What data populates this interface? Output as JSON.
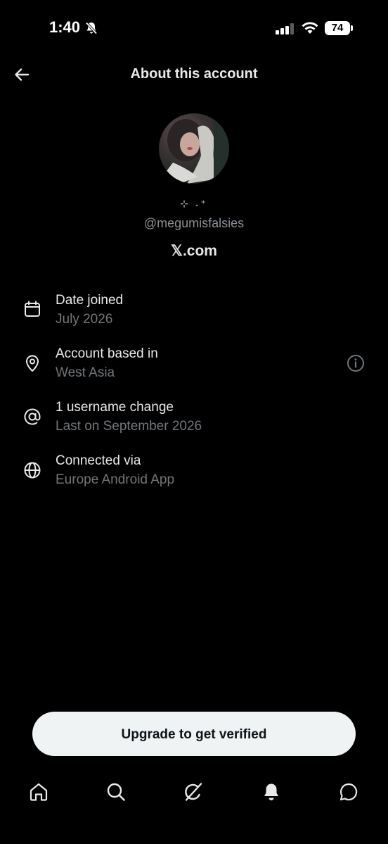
{
  "status_bar": {
    "time": "1:40",
    "battery": "74",
    "icons": [
      "bell-slash-icon",
      "cellular-signal-icon",
      "wifi-icon",
      "battery-icon"
    ]
  },
  "header": {
    "title": "About this account",
    "back_icon": "arrow-left-icon"
  },
  "profile": {
    "avatar": "profile-photo",
    "display_name": "⊹ ˖⁺",
    "handle": "@megumisfalsies",
    "site": "𝕏.com"
  },
  "details": [
    {
      "icon": "calendar-icon",
      "label": "Date joined",
      "value": "July 2026"
    },
    {
      "icon": "location-pin-icon",
      "label": "Account based in",
      "value": "West Asia",
      "info_icon": "info-circle-icon"
    },
    {
      "icon": "at-sign-icon",
      "label": "1 username change",
      "value": "Last on September 2026"
    },
    {
      "icon": "globe-icon",
      "label": "Connected via",
      "value": "Europe Android App"
    }
  ],
  "actions": {
    "upgrade_label": "Upgrade to get verified"
  },
  "bottom_nav": [
    "home-icon",
    "search-icon",
    "grok-icon",
    "notifications-bell-icon",
    "chat-bubble-icon"
  ],
  "colors": {
    "background": "#000000",
    "primary_text": "#e7e9ea",
    "secondary_text": "#71767b",
    "button_bg": "#eff3f4"
  }
}
